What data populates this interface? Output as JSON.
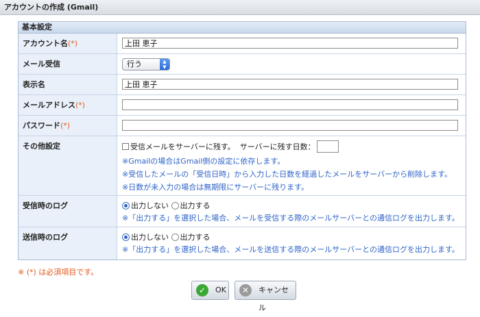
{
  "window": {
    "title": "アカウントの作成 (Gmail)"
  },
  "section": {
    "title": "基本設定"
  },
  "fields": {
    "account_name": {
      "label": "アカウント名",
      "required_mark": "(*)",
      "value": "上田 恵子"
    },
    "mail_receive": {
      "label": "メール受信",
      "selected": "行う"
    },
    "display_name": {
      "label": "表示名",
      "value": "上田 恵子"
    },
    "mail_address": {
      "label": "メールアドレス",
      "required_mark": "(*)",
      "value": ""
    },
    "password": {
      "label": "パスワード",
      "required_mark": "(*)",
      "value": ""
    },
    "other": {
      "label": "その他設定",
      "leave_on_server_label": "受信メールをサーバーに残す。",
      "days_label": "サーバーに残す日数：",
      "days_value": "",
      "notes": [
        "※Gmailの場合はGmail側の設定に依存します。",
        "※受信したメールの「受信日時」から入力した日数を経過したメールをサーバーから削除します。",
        "※日数が未入力の場合は無期限にサーバーに残ります。"
      ]
    },
    "receive_log": {
      "label": "受信時のログ",
      "option_off": "出力しない",
      "option_on": "出力する",
      "note": "※「出力する」を選択した場合、メールを受信する際のメールサーバーとの通信ログを出力します。"
    },
    "send_log": {
      "label": "送信時のログ",
      "option_off": "出力しない",
      "option_on": "出力する",
      "note": "※「出力する」を選択した場合、メールを送信する際のメールサーバーとの通信ログを出力します。"
    }
  },
  "required_note": "※ (*) は必須項目です。",
  "buttons": {
    "ok": "OK",
    "cancel": "キャンセル"
  },
  "colors": {
    "required": "#e05a1e",
    "note": "#2f64c8",
    "label_bg": "#e9f0f9"
  }
}
